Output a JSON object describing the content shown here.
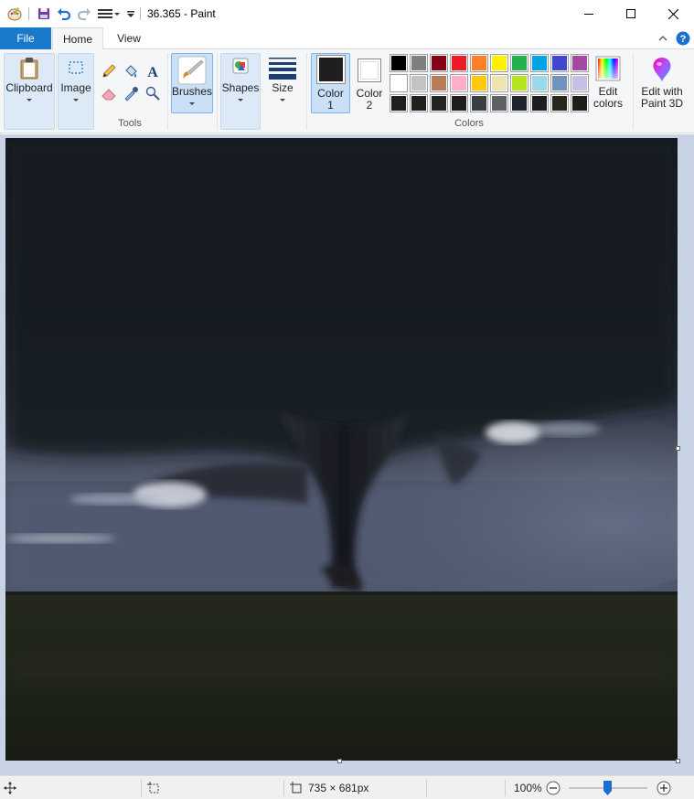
{
  "window": {
    "title": "36.365 - Paint"
  },
  "tabs": {
    "file": "File",
    "home": "Home",
    "view": "View"
  },
  "ribbon": {
    "clipboard_label": "Clipboard",
    "image_label": "Image",
    "tools_label": "Tools",
    "brushes_label": "Brushes",
    "shapes_label": "Shapes",
    "size_label": "Size",
    "color1_label_line1": "Color",
    "color1_label_line2": "1",
    "color2_label_line1": "Color",
    "color2_label_line2": "2",
    "colors_group_label": "Colors",
    "edit_colors_line1": "Edit",
    "edit_colors_line2": "colors",
    "paint3d_line1": "Edit with",
    "paint3d_line2": "Paint 3D",
    "color1_value": "#1f1f1f",
    "color2_value": "#ffffff"
  },
  "palette": {
    "row1": [
      "#000000",
      "#7f7f7f",
      "#880015",
      "#ed1c24",
      "#ff7f27",
      "#fff200",
      "#22b14c",
      "#00a2e8",
      "#3f48cc",
      "#a349a4"
    ],
    "row2": [
      "#ffffff",
      "#c3c3c3",
      "#b97a57",
      "#ffaec9",
      "#ffc90e",
      "#efe4b0",
      "#b5e61d",
      "#99d9ea",
      "#7092be",
      "#c8bfe7"
    ],
    "row3": [
      "#1f1f1f",
      "#20211c",
      "#23231d",
      "#1e1f1c",
      "#3a3d42",
      "#5f6166",
      "#222530",
      "#1b1d22",
      "#262820",
      "#1c1e1a"
    ]
  },
  "status": {
    "dimensions": "735 × 681px",
    "zoom": "100%",
    "zoom_level": 1.0
  },
  "image": {
    "description_icon": "tornado-painting"
  }
}
